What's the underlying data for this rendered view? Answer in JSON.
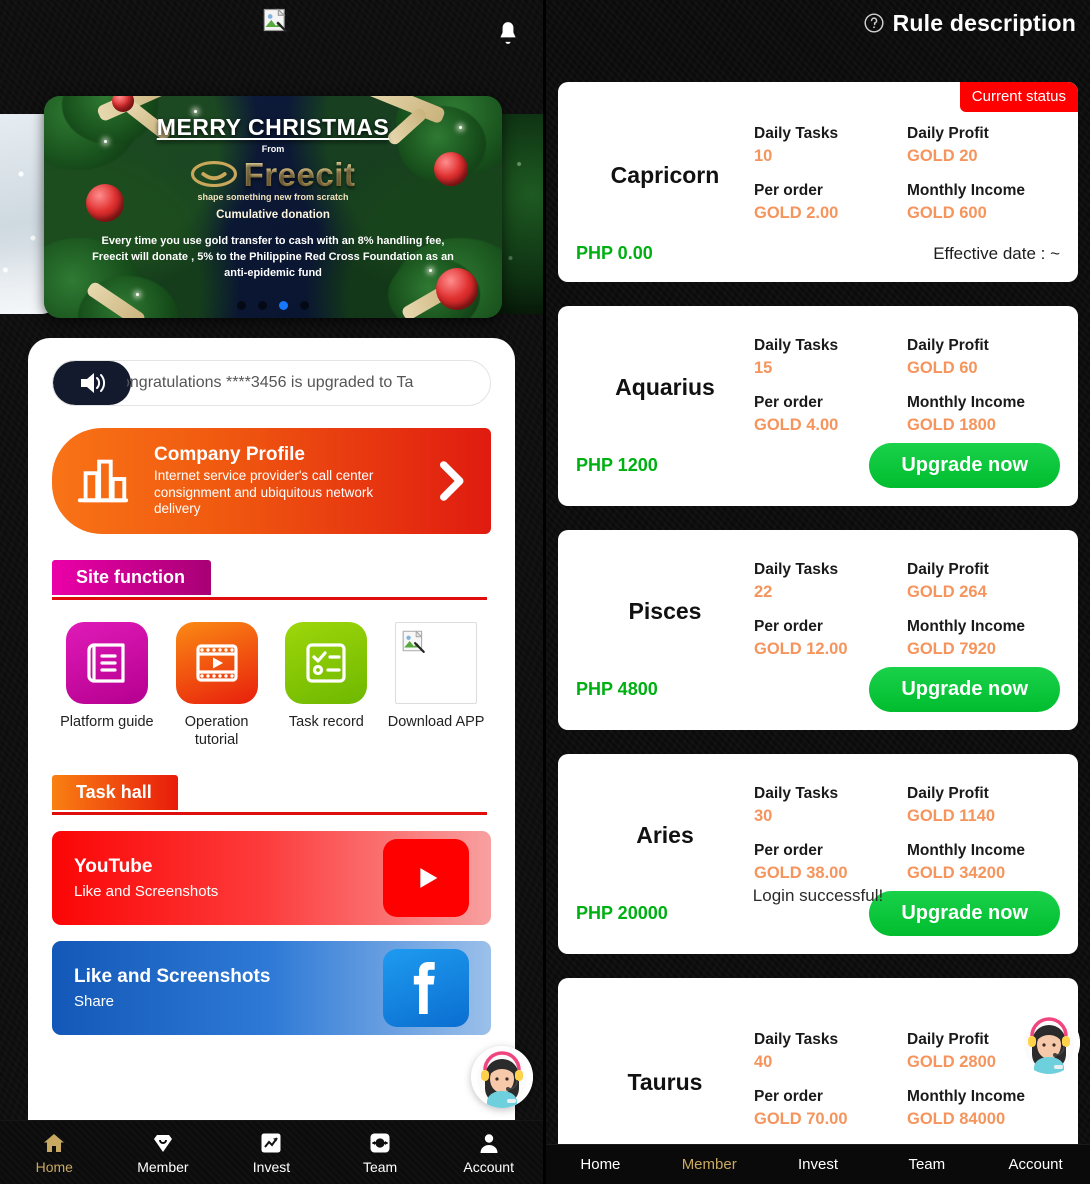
{
  "left": {
    "topbar": {
      "logo_alt": "broken-image",
      "bell_icon": "bell-icon"
    },
    "carousel": {
      "slide": {
        "title": "MERRY CHRISTMAS",
        "from": "From",
        "brand": "Freecit",
        "tagline": "shape something new from scratch",
        "subtitle": "Cumulative donation",
        "body": "Every time you use gold transfer to cash with an 8% handling fee, Freecit will donate , 5% to the Philippine Red Cross Foundation as an anti-epidemic fund"
      },
      "dot_count": 4,
      "active_dot": 2
    },
    "notice": {
      "icon": "speaker-icon",
      "text": "ongratulations ****3456 is upgraded to Ta"
    },
    "company": {
      "title": "Company Profile",
      "desc": "Internet service provider's call center consignment and ubiquitous network delivery",
      "arrow_icon": "chevron-right-icon"
    },
    "site_function": {
      "heading": "Site function",
      "items": [
        {
          "label": "Platform guide",
          "icon": "guide-book-icon"
        },
        {
          "label": "Operation tutorial",
          "icon": "video-play-icon"
        },
        {
          "label": "Task record",
          "icon": "checklist-icon"
        },
        {
          "label": "Download APP",
          "icon": "broken-image-icon"
        }
      ]
    },
    "task_hall": {
      "heading": "Task hall",
      "items": [
        {
          "title": "YouTube",
          "sub": "Like and Screenshots",
          "logo": "youtube-icon"
        },
        {
          "title": "Like and Screenshots",
          "sub": "Share",
          "logo": "facebook-icon"
        }
      ]
    },
    "nav": [
      {
        "label": "Home",
        "icon": "home-icon",
        "active": true
      },
      {
        "label": "Member",
        "icon": "diamond-heart-icon",
        "active": false
      },
      {
        "label": "Invest",
        "icon": "trending-up-icon",
        "active": false
      },
      {
        "label": "Team",
        "icon": "team-arrows-icon",
        "active": false
      },
      {
        "label": "Account",
        "icon": "person-icon",
        "active": false
      }
    ],
    "support_widget": "customer-service-avatar"
  },
  "right": {
    "header": {
      "icon": "question-circle-icon",
      "title": "Rule description"
    },
    "labels": {
      "daily_tasks": "Daily Tasks",
      "daily_profit": "Daily Profit",
      "per_order": "Per order",
      "monthly_income": "Monthly Income",
      "current_status": "Current status",
      "upgrade": "Upgrade now"
    },
    "levels": [
      {
        "name": "Capricorn",
        "daily_tasks": "10",
        "daily_profit": "GOLD 20",
        "per_order": "GOLD 2.00",
        "monthly_income": "GOLD 600",
        "price": "PHP 0.00",
        "current": true,
        "effective": "Effective date : ~"
      },
      {
        "name": "Aquarius",
        "daily_tasks": "15",
        "daily_profit": "GOLD 60",
        "per_order": "GOLD 4.00",
        "monthly_income": "GOLD 1800",
        "price": "PHP 1200",
        "current": false,
        "effective": ""
      },
      {
        "name": "Pisces",
        "daily_tasks": "22",
        "daily_profit": "GOLD 264",
        "per_order": "GOLD 12.00",
        "monthly_income": "GOLD 7920",
        "price": "PHP 4800",
        "current": false,
        "effective": ""
      },
      {
        "name": "Aries",
        "daily_tasks": "30",
        "daily_profit": "GOLD 1140",
        "per_order": "GOLD 38.00",
        "monthly_income": "GOLD 34200",
        "price": "PHP 20000",
        "current": false,
        "effective": ""
      },
      {
        "name": "Taurus",
        "daily_tasks": "40",
        "daily_profit": "GOLD 2800",
        "per_order": "GOLD 70.00",
        "monthly_income": "GOLD 84000",
        "price": "",
        "current": false,
        "effective": ""
      }
    ],
    "toast": "Login successful!",
    "nav": [
      {
        "label": "Home",
        "active": false
      },
      {
        "label": "Member",
        "active": true
      },
      {
        "label": "Invest",
        "active": false
      },
      {
        "label": "Team",
        "active": false
      },
      {
        "label": "Account",
        "active": false
      }
    ],
    "support_widget": "customer-service-avatar"
  },
  "colors": {
    "accent_orange": "#f5945c",
    "accent_green": "#00b012",
    "badge_red": "#ff0000",
    "nav_active_gold": "#c9a961",
    "upgrade_green": "#00bd2e"
  }
}
